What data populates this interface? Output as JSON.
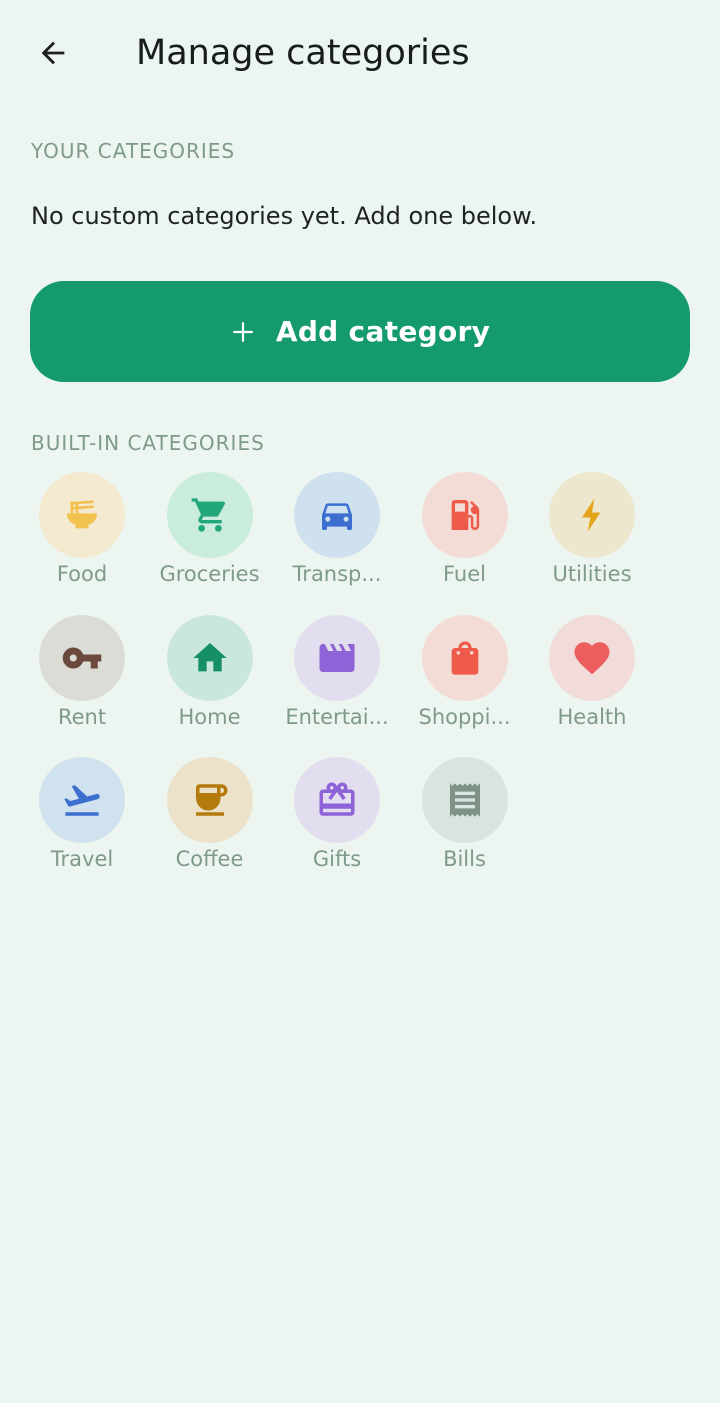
{
  "header": {
    "title": "Manage categories",
    "back_icon": "arrow-left-icon"
  },
  "your_categories": {
    "label": "YOUR CATEGORIES",
    "empty_message": "No custom categories yet. Add one below."
  },
  "add_button": {
    "label": "Add category",
    "icon": "plus-icon",
    "color": "#149a6d"
  },
  "built_in": {
    "label": "BUILT-IN CATEGORIES",
    "items": [
      {
        "label": "Food",
        "icon": "ramen-bowl-icon",
        "bg": "#f3ead0",
        "fg": "#f2c14e"
      },
      {
        "label": "Groceries",
        "icon": "shopping-cart-icon",
        "bg": "#c9ecdc",
        "fg": "#21a77a"
      },
      {
        "label": "Transp...",
        "icon": "car-icon",
        "bg": "#cfe0ee",
        "fg": "#3d6fd1"
      },
      {
        "label": "Fuel",
        "icon": "fuel-pump-icon",
        "bg": "#f4dcd6",
        "fg": "#ef5b4a"
      },
      {
        "label": "Utilities",
        "icon": "lightning-bolt-icon",
        "bg": "#ede7cd",
        "fg": "#e5a51a"
      },
      {
        "label": "Rent",
        "icon": "key-icon",
        "bg": "#dcdcd7",
        "fg": "#6b4a3d"
      },
      {
        "label": "Home",
        "icon": "house-icon",
        "bg": "#c9e7da",
        "fg": "#158f68"
      },
      {
        "label": "Entertai...",
        "icon": "clapperboard-icon",
        "bg": "#e2def0",
        "fg": "#8f63d8"
      },
      {
        "label": "Shoppi...",
        "icon": "shopping-bag-icon",
        "bg": "#f4dcd6",
        "fg": "#ef5b4a"
      },
      {
        "label": "Health",
        "icon": "heart-icon",
        "bg": "#f2dcd9",
        "fg": "#ec5d5d"
      },
      {
        "label": "Travel",
        "icon": "airplane-icon",
        "bg": "#d0e2ee",
        "fg": "#3d6fd1"
      },
      {
        "label": "Coffee",
        "icon": "coffee-cup-icon",
        "bg": "#ebe2c9",
        "fg": "#b57a0c"
      },
      {
        "label": "Gifts",
        "icon": "gift-card-icon",
        "bg": "#e2def0",
        "fg": "#8f63d8"
      },
      {
        "label": "Bills",
        "icon": "receipt-icon",
        "bg": "#d9e3df",
        "fg": "#7e9288"
      }
    ]
  }
}
